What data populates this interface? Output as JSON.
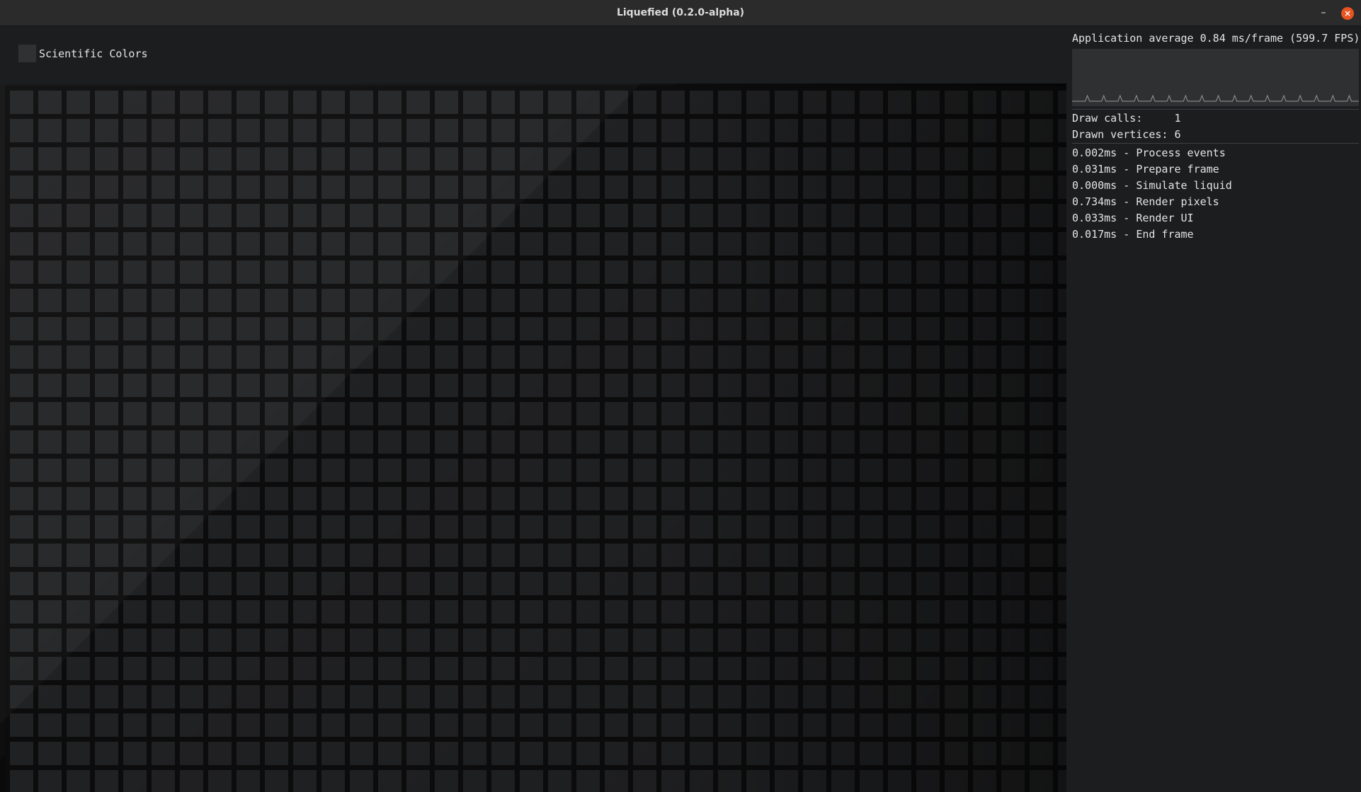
{
  "window": {
    "title": "Liquefied (0.2.0-alpha)",
    "minimize_symbol": "–",
    "close_symbol": "×",
    "close_color": "#e95420"
  },
  "toolbar": {
    "scientific_colors": {
      "label": "Scientific Colors",
      "checked": false
    }
  },
  "stats": {
    "average_text": "Application average 0.84 ms/frame (599.7 FPS)",
    "draw_calls_label": "Draw calls:",
    "draw_calls_value": "1",
    "drawn_vertices_label": "Drawn vertices:",
    "drawn_vertices_value": "6",
    "timings": [
      {
        "time": "0.002ms",
        "label": "Process events"
      },
      {
        "time": "0.031ms",
        "label": "Prepare frame"
      },
      {
        "time": "0.000ms",
        "label": "Simulate liquid"
      },
      {
        "time": "0.734ms",
        "label": "Render pixels"
      },
      {
        "time": "0.033ms",
        "label": "Render UI"
      },
      {
        "time": "0.017ms",
        "label": "End frame"
      }
    ],
    "graph_spike_count": 17
  },
  "colors": {
    "background": "#1c1d1f",
    "canvas": "#0e0e0e",
    "grid_cell": "#252628",
    "text": "#e4e4e4"
  }
}
